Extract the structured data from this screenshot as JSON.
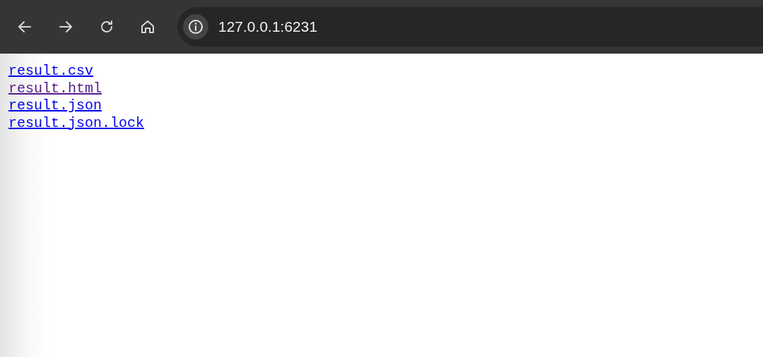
{
  "toolbar": {
    "url": "127.0.0.1:6231"
  },
  "links": [
    {
      "label": "result.csv",
      "visited": false
    },
    {
      "label": "result.html",
      "visited": true
    },
    {
      "label": "result.json",
      "visited": false
    },
    {
      "label": "result.json.lock",
      "visited": false
    }
  ]
}
